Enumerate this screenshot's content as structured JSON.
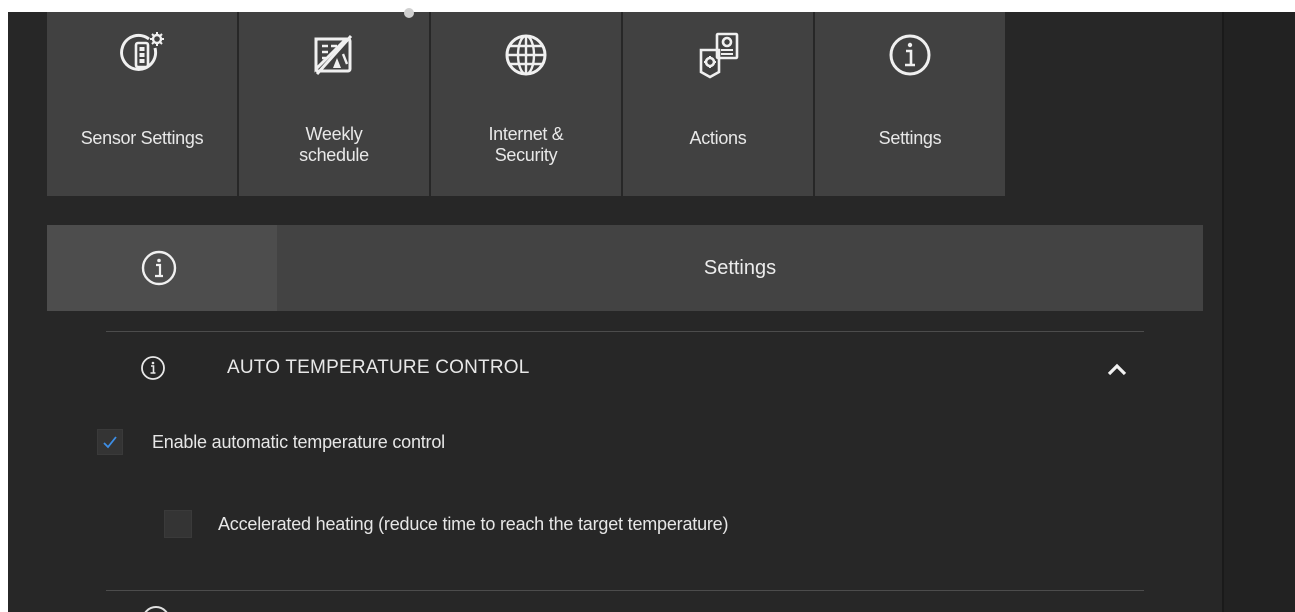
{
  "tiles": [
    {
      "label": "Sensor Settings",
      "icon": "sensor-settings-icon"
    },
    {
      "label": "Weekly\nschedule",
      "icon": "weekly-schedule-icon"
    },
    {
      "label": "Internet &\nSecurity",
      "icon": "globe-icon"
    },
    {
      "label": "Actions",
      "icon": "actions-icon"
    },
    {
      "label": "Settings",
      "icon": "info-icon"
    }
  ],
  "header": {
    "title": "Settings",
    "icon": "info-icon"
  },
  "section": {
    "title": "AUTO TEMPERATURE CONTROL",
    "icon": "info-icon",
    "expanded": true
  },
  "options": [
    {
      "label": "Enable automatic temperature control",
      "checked": true
    },
    {
      "label": "Accelerated heating (reduce time to reach the target temperature)",
      "checked": false
    }
  ],
  "colors": {
    "background": "#272727",
    "tile": "#414141",
    "header": "#434343",
    "check": "#3d8ee6"
  }
}
